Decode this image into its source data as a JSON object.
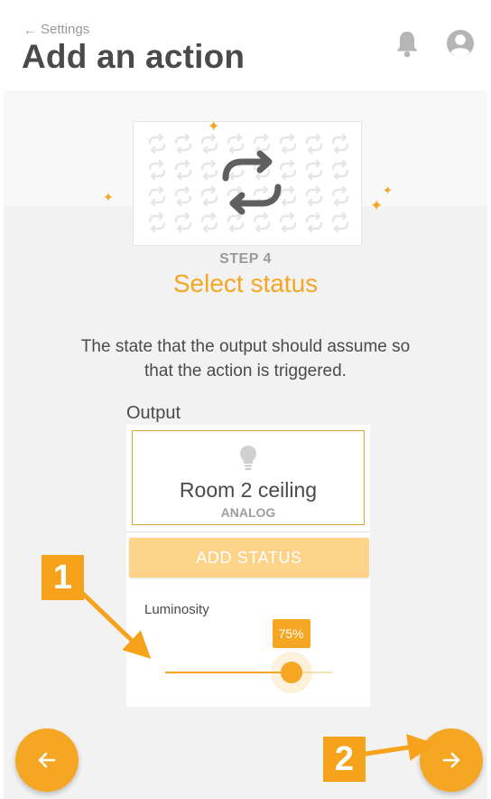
{
  "header": {
    "back_label": "Settings",
    "title": "Add an action",
    "icons": [
      "bell-icon",
      "user-avatar-icon"
    ]
  },
  "hero": {
    "icon": "repeat-icon",
    "accent_color": "#f5a623"
  },
  "step": {
    "label": "STEP 4",
    "title": "Select status",
    "description": "The state that the output should assume so that the action is triggered."
  },
  "output": {
    "section_label": "Output",
    "name": "Room 2 ceiling",
    "type": "ANALOG",
    "icon": "lightbulb-icon"
  },
  "add_status_label": "ADD STATUS",
  "luminosity": {
    "label": "Luminosity",
    "value_text": "75%",
    "value": 75
  },
  "nav": {
    "prev_icon": "arrow-left-icon",
    "next_icon": "arrow-right-icon"
  },
  "callouts": [
    "1",
    "2"
  ]
}
